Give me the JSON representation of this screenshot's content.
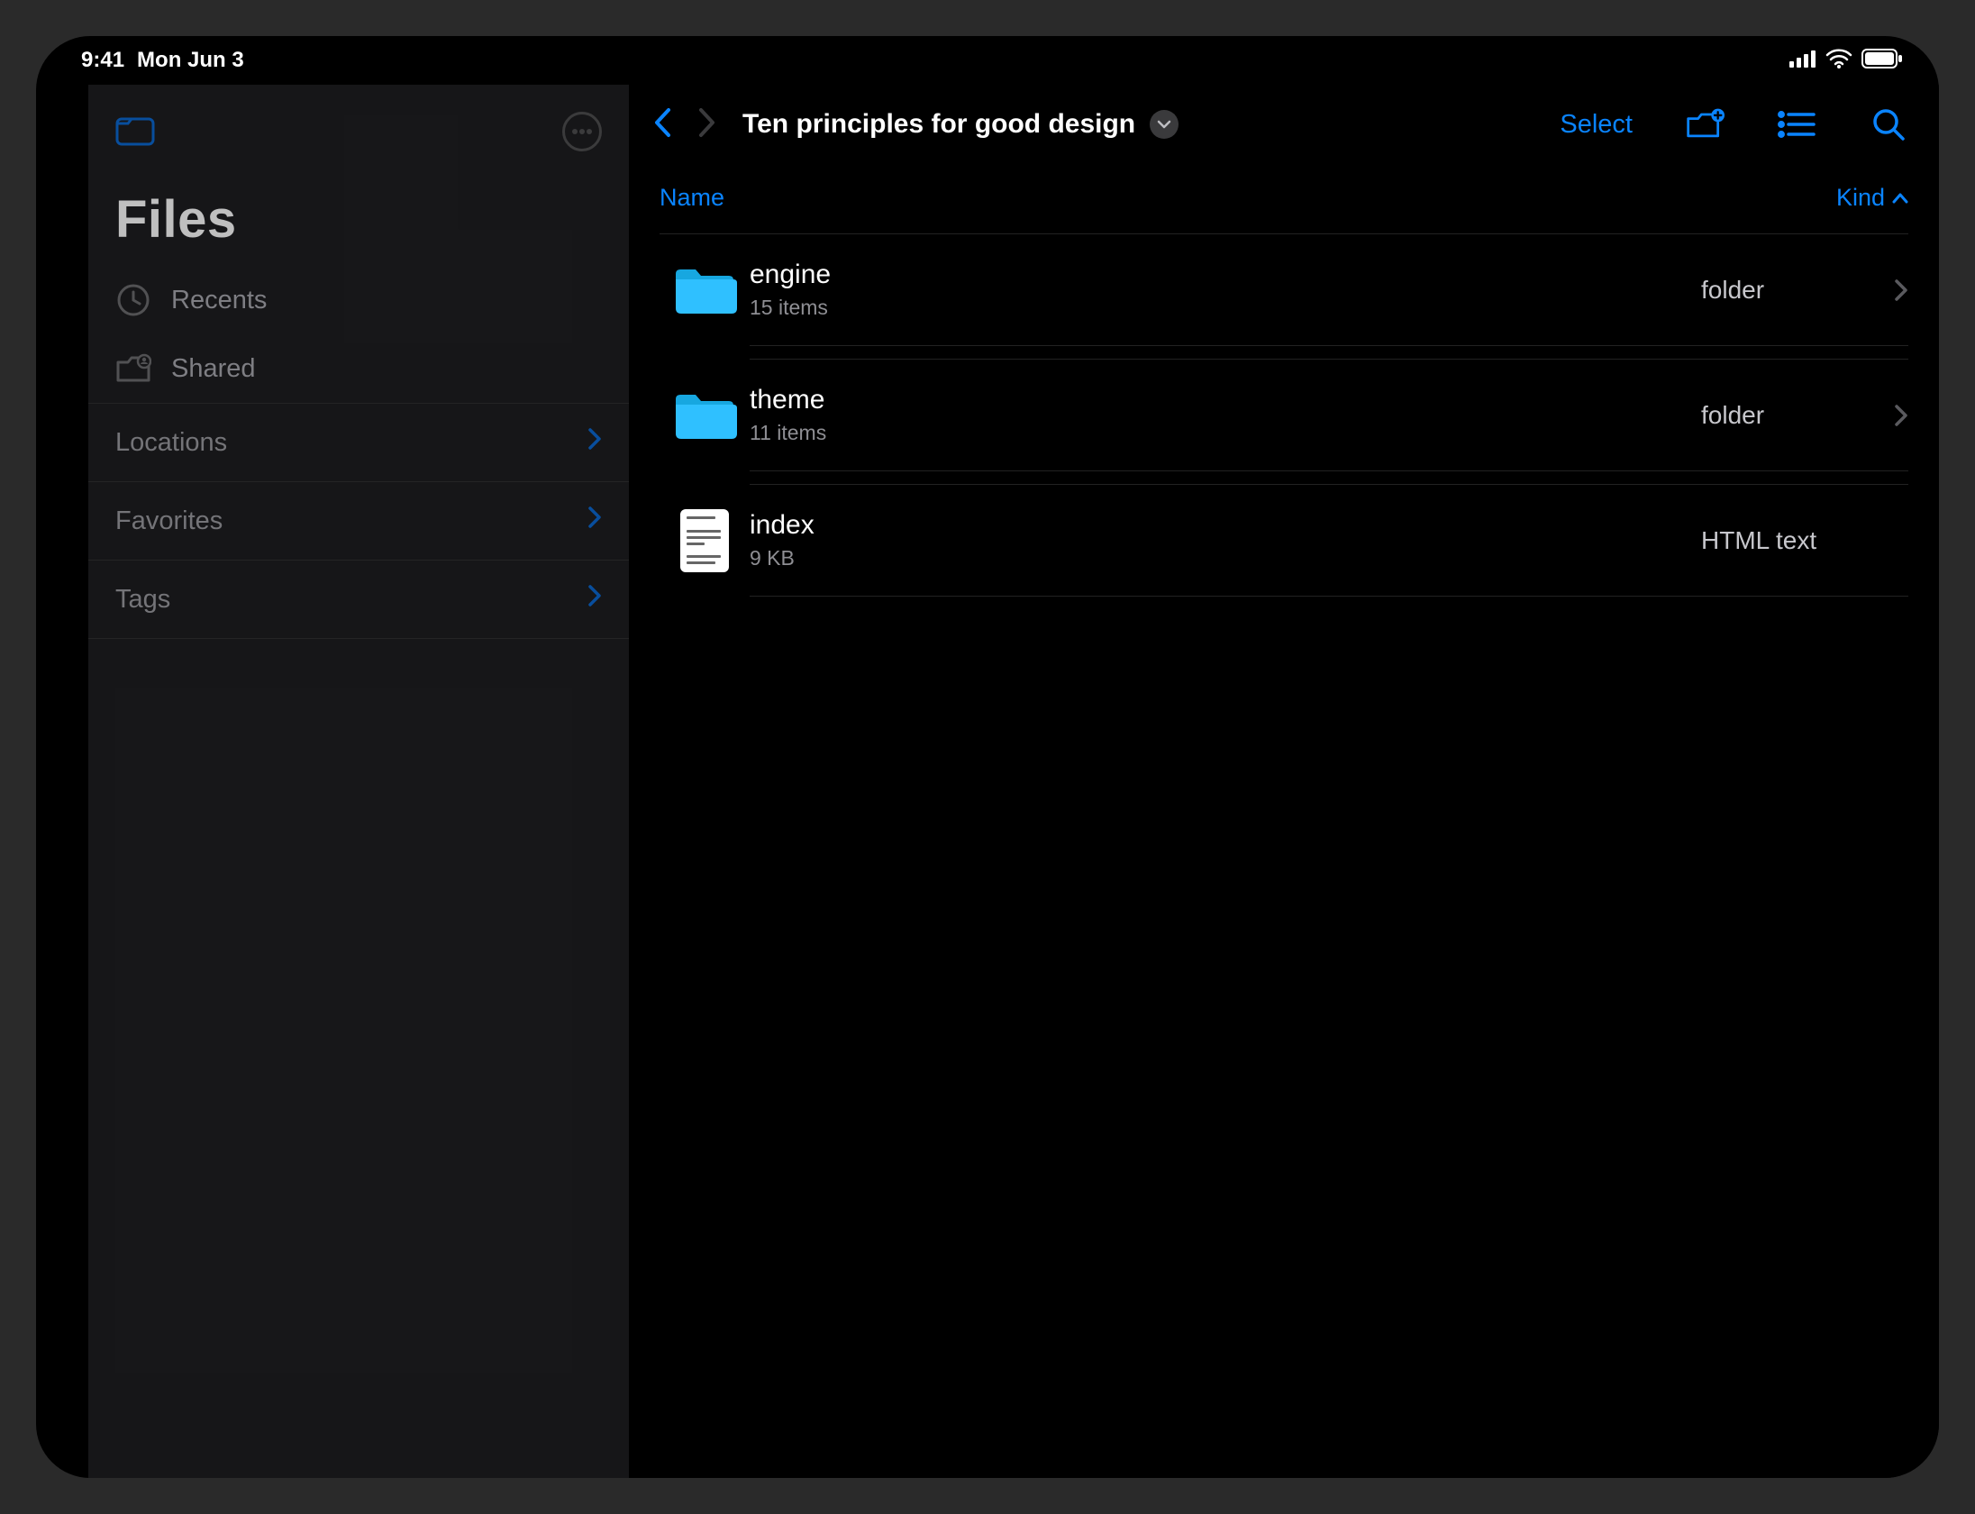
{
  "statusbar": {
    "time": "9:41",
    "date": "Mon Jun 3"
  },
  "sidebar": {
    "title": "Files",
    "recents_label": "Recents",
    "shared_label": "Shared",
    "sections": {
      "locations": "Locations",
      "favorites": "Favorites",
      "tags": "Tags"
    }
  },
  "toolbar": {
    "title": "Ten principles for good design",
    "select_label": "Select"
  },
  "columns": {
    "name": "Name",
    "kind": "Kind"
  },
  "rows": [
    {
      "name": "engine",
      "sub": "15 items",
      "kind": "folder",
      "type": "folder"
    },
    {
      "name": "theme",
      "sub": "11 items",
      "kind": "folder",
      "type": "folder"
    },
    {
      "name": "index",
      "sub": "9 KB",
      "kind": "HTML text",
      "type": "file"
    }
  ],
  "colors": {
    "accent": "#0a84ff",
    "folder": "#2fc0ff"
  }
}
